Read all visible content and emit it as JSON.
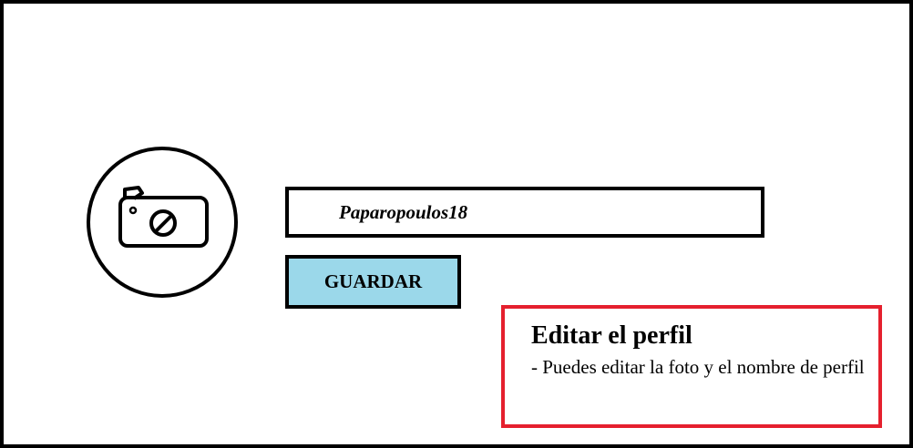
{
  "profile_editor": {
    "photo_icon": "camera-icon",
    "username_value": "Paparopoulos18",
    "save_label": "GUARDAR"
  },
  "hint": {
    "title": "Editar el perfil",
    "text": "- Puedes editar la foto y el nombre de perfil"
  },
  "colors": {
    "frame_border": "#000000",
    "save_button_bg": "#9bd8ea",
    "hint_border": "#e5202e"
  }
}
